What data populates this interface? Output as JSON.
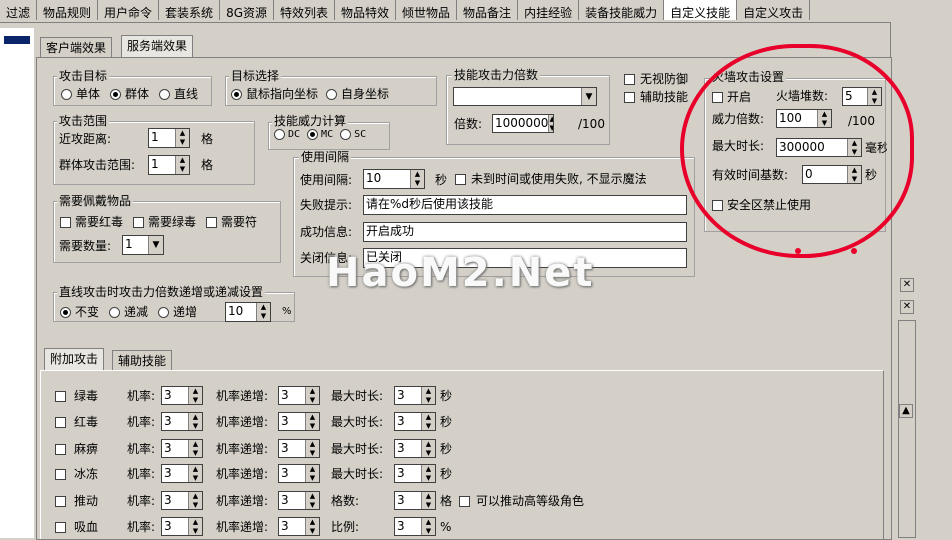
{
  "top_tabs": [
    "过滤",
    "物品规则",
    "用户命令",
    "套装系统",
    "8G资源",
    "特效列表",
    "物品特效",
    "倾世物品",
    "物品备注",
    "内挂经验",
    "装备技能威力",
    "自定义技能",
    "自定义攻击"
  ],
  "tabs": {
    "client": "客户端效果",
    "server": "服务端效果"
  },
  "attack_target": {
    "title": "攻击目标",
    "options": [
      "单体",
      "群体",
      "直线"
    ],
    "selected": 1
  },
  "target_select": {
    "title": "目标选择",
    "options": [
      "鼠标指向坐标",
      "自身坐标"
    ],
    "selected": 0
  },
  "power_multiplier": {
    "title": "技能攻击力倍数",
    "dropdown_value": "",
    "label": "倍数:",
    "value": "1000000",
    "unit": "/100"
  },
  "invisible_defense": "无视防御",
  "assist_skill": "辅助技能",
  "attack_range": {
    "title": "攻击范围",
    "near_label": "近攻距离:",
    "near_value": "1",
    "unit": "格",
    "group_label": "群体攻击范围:",
    "group_value": "1"
  },
  "power_calc": {
    "title": "技能威力计算",
    "options": [
      "DC",
      "MC",
      "SC"
    ],
    "selected": 1
  },
  "use_interval": {
    "title": "使用间隔",
    "interval_label": "使用间隔:",
    "interval_value": "10",
    "interval_unit": "秒",
    "no_show_label": "未到时间或使用失败, 不显示魔法",
    "fail_label": "失败提示:",
    "fail_value": "请在%d秒后使用该技能",
    "success_label": "成功信息:",
    "success_value": "开启成功",
    "close_label": "关闭信息:",
    "close_value": "已关闭"
  },
  "equip_items": {
    "title": "需要佩戴物品",
    "options": [
      "需要红毒",
      "需要绿毒",
      "需要符"
    ],
    "count_label": "需要数量:",
    "count_value": "1"
  },
  "linear": {
    "title": "直线攻击时攻击力倍数递增或递减设置",
    "options": [
      "不变",
      "递减",
      "递增"
    ],
    "selected": 0,
    "value": "10",
    "unit": "%"
  },
  "bottom_tabs": {
    "attach": "附加攻击",
    "assist": "辅助技能"
  },
  "attach_rows": [
    {
      "name": "绿毒",
      "rate_label": "机率:",
      "rate": "3",
      "inc_label": "机率递增:",
      "inc": "3",
      "third_label": "最大时长:",
      "third": "3",
      "unit": "秒"
    },
    {
      "name": "红毒",
      "rate_label": "机率:",
      "rate": "3",
      "inc_label": "机率递增:",
      "inc": "3",
      "third_label": "最大时长:",
      "third": "3",
      "unit": "秒"
    },
    {
      "name": "麻痹",
      "rate_label": "机率:",
      "rate": "3",
      "inc_label": "机率递增:",
      "inc": "3",
      "third_label": "最大时长:",
      "third": "3",
      "unit": "秒"
    },
    {
      "name": "冰冻",
      "rate_label": "机率:",
      "rate": "3",
      "inc_label": "机率递增:",
      "inc": "3",
      "third_label": "最大时长:",
      "third": "3",
      "unit": "秒"
    },
    {
      "name": "推动",
      "rate_label": "机率:",
      "rate": "3",
      "inc_label": "机率递增:",
      "inc": "3",
      "third_label": "格数:",
      "third": "3",
      "unit": "格",
      "extra": "可以推动高等级角色"
    },
    {
      "name": "吸血",
      "rate_label": "机率:",
      "rate": "3",
      "inc_label": "机率递增:",
      "inc": "3",
      "third_label": "比例:",
      "third": "3",
      "unit": "%"
    }
  ],
  "firewall": {
    "title": "火墙攻击设置",
    "open_label": "开启",
    "stack_label": "火墙堆数:",
    "stack_value": "5",
    "power_label": "威力倍数:",
    "power_value": "100",
    "power_unit": "/100",
    "max_label": "最大时长:",
    "max_value": "300000",
    "max_unit": "毫秒",
    "base_label": "有效时间基数:",
    "base_value": "0",
    "base_unit": "秒",
    "safe_label": "安全区禁止使用"
  },
  "watermark": "HaoM2.Net",
  "colors": {
    "highlight": "#e8002a",
    "selection": "#0a246a"
  }
}
